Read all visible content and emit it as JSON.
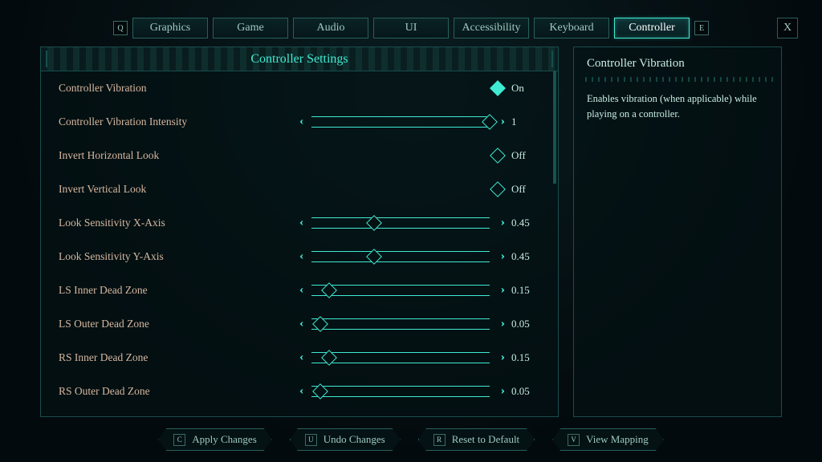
{
  "tabs": {
    "prev_key": "Q",
    "next_key": "E",
    "items": [
      "Graphics",
      "Game",
      "Audio",
      "UI",
      "Accessibility",
      "Keyboard",
      "Controller"
    ],
    "active_index": 6
  },
  "close_label": "X",
  "panel_title": "Controller Settings",
  "settings": [
    {
      "id": "vibration",
      "label": "Controller Vibration",
      "type": "toggle",
      "value_text": "On",
      "on": true
    },
    {
      "id": "vibration_int",
      "label": "Controller Vibration Intensity",
      "type": "slider",
      "value_text": "1",
      "pos": 1.0
    },
    {
      "id": "invert_h",
      "label": "Invert Horizontal Look",
      "type": "toggle",
      "value_text": "Off",
      "on": false
    },
    {
      "id": "invert_v",
      "label": "Invert Vertical Look",
      "type": "toggle",
      "value_text": "Off",
      "on": false
    },
    {
      "id": "sens_x",
      "label": "Look Sensitivity X-Axis",
      "type": "slider",
      "value_text": "0.45",
      "pos": 0.35
    },
    {
      "id": "sens_y",
      "label": "Look Sensitivity Y-Axis",
      "type": "slider",
      "value_text": "0.45",
      "pos": 0.35
    },
    {
      "id": "ls_inner",
      "label": "LS Inner Dead Zone",
      "type": "slider",
      "value_text": "0.15",
      "pos": 0.1
    },
    {
      "id": "ls_outer",
      "label": "LS Outer Dead Zone",
      "type": "slider",
      "value_text": "0.05",
      "pos": 0.05
    },
    {
      "id": "rs_inner",
      "label": "RS Inner Dead Zone",
      "type": "slider",
      "value_text": "0.15",
      "pos": 0.1
    },
    {
      "id": "rs_outer",
      "label": "RS Outer Dead Zone",
      "type": "slider",
      "value_text": "0.05",
      "pos": 0.05
    }
  ],
  "info": {
    "title": "Controller Vibration",
    "body": "Enables vibration (when applicable) while playing on a controller."
  },
  "footer": [
    {
      "key": "C",
      "label": "Apply Changes"
    },
    {
      "key": "U",
      "label": "Undo Changes"
    },
    {
      "key": "R",
      "label": "Reset to Default"
    },
    {
      "key": "V",
      "label": "View Mapping"
    }
  ]
}
